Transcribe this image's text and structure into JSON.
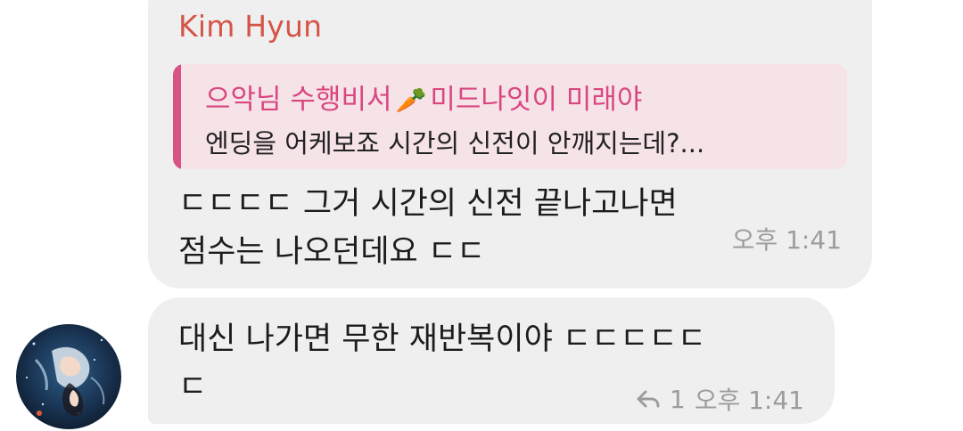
{
  "messages": [
    {
      "sender": "Kim Hyun",
      "sender_color": "#d45548",
      "quote": {
        "author_part1": "으악님 수행비서",
        "author_emoji": "🥕",
        "author_part2": "미드나잇이 미래야",
        "text": "엔딩을 어케보죠 시간의 신전이 안깨지는데?..."
      },
      "text": "ㄷㄷㄷㄷ 그거 시간의 신전 끝나고나면\n점수는 나오던데요 ㄷㄷ",
      "time": "오후 1:41"
    },
    {
      "text": "대신 나가면 무한 재반복이야 ㄷㄷㄷㄷㄷ\nㄷ",
      "reply_count": "1",
      "time": "오후 1:41"
    }
  ],
  "colors": {
    "bubble_bg": "#efefef",
    "quote_bg": "#f6e3e8",
    "quote_bar": "#d95286",
    "quote_author": "#d94681",
    "meta": "#9c9c9c"
  },
  "icons": {
    "reply": "reply-arrow-icon",
    "avatar": "user-avatar-illustration"
  }
}
